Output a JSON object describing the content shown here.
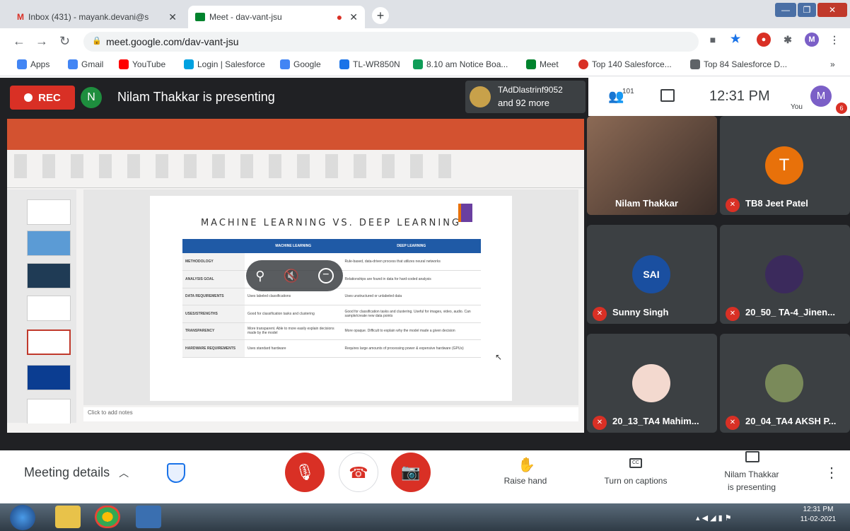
{
  "browser": {
    "tabs": [
      {
        "title": "Inbox (431) - mayank.devani@s",
        "icon": "gmail-icon"
      },
      {
        "title": "Meet - dav-vant-jsu",
        "icon": "meet-icon"
      }
    ],
    "url": "meet.google.com/dav-vant-jsu",
    "profile_initial": "M",
    "bookmarks": [
      {
        "label": "Apps",
        "color": "#4285f4"
      },
      {
        "label": "Gmail",
        "color": "#4285f4"
      },
      {
        "label": "YouTube",
        "color": "#ff0000"
      },
      {
        "label": "Login | Salesforce",
        "color": "#00a1e0"
      },
      {
        "label": "Google",
        "color": "#4285f4"
      },
      {
        "label": "TL-WR850N",
        "color": "#1a73e8"
      },
      {
        "label": "8.10 am Notice Boa...",
        "color": "#0f9d58"
      },
      {
        "label": "Meet",
        "color": "#00832d"
      },
      {
        "label": "Top 140 Salesforce...",
        "color": "#d93025"
      },
      {
        "label": "Top 84 Salesforce D...",
        "color": "#5f6368"
      }
    ]
  },
  "meet": {
    "rec_label": "REC",
    "presenter_initial": "N",
    "presenting_text": "Nilam Thakkar is presenting",
    "chip_line1": "TAdDlastrinf9052",
    "chip_line2": "and 92 more",
    "participant_count": "101",
    "clock": "12:31 PM",
    "you_label": "You",
    "user_initial": "M",
    "notification_count": "6"
  },
  "slide": {
    "title": "MACHINE LEARNING VS. DEEP LEARNING",
    "headers": [
      "",
      "MACHINE LEARNING",
      "DEEP LEARNING"
    ],
    "rows": [
      {
        "label": "METHODOLOGY",
        "ml": "",
        "dl": "Rule-based, data-driven process that utilizes neural networks"
      },
      {
        "label": "ANALYSIS GOAL",
        "ml": "",
        "dl": "Relationships are found in data for hard-coded analysis"
      },
      {
        "label": "DATA REQUIREMENTS",
        "ml": "Uses labeled classifications",
        "dl": "Uses unstructured or unlabeled data"
      },
      {
        "label": "USES/STRENGTHS",
        "ml": "Good for classification tasks and clustering",
        "dl": "Good for classification tasks and clustering. Useful for images, video, audio. Can sample/create new data points"
      },
      {
        "label": "TRANSPARENCY",
        "ml": "More transparent. Able to more easily explain decisions made by the model",
        "dl": "More opaque. Difficult to explain why the model made a given decision"
      },
      {
        "label": "HARDWARE REQUIREMENTS",
        "ml": "Uses standard hardware",
        "dl": "Requires large amounts of processing power & expensive hardware (GPUs)"
      }
    ],
    "notes_placeholder": "Click to add notes"
  },
  "participants": [
    {
      "name": "Nilam Thakkar",
      "initial": "",
      "color": "#6b4a3a",
      "muted": false
    },
    {
      "name": "TB8 Jeet Patel",
      "initial": "T",
      "color": "#e8710a",
      "muted": true
    },
    {
      "name": "Sunny Singh",
      "initial": "SAI",
      "color": "#1a4fa0",
      "muted": true
    },
    {
      "name": "20_50_ TA-4_Jinen...",
      "initial": "",
      "color": "#3b2a5c",
      "muted": true
    },
    {
      "name": "20_13_TA4 Mahim...",
      "initial": "",
      "color": "#f3d9cf",
      "muted": true
    },
    {
      "name": "20_04_TA4 AKSH P...",
      "initial": "",
      "color": "#7a8a5a",
      "muted": true
    }
  ],
  "bottombar": {
    "meeting_details": "Meeting details",
    "raise_hand": "Raise hand",
    "captions": "Turn on captions",
    "presenting_line1": "Nilam Thakkar",
    "presenting_line2": "is presenting"
  },
  "taskbar": {
    "time": "12:31 PM",
    "date": "11-02-2021"
  }
}
